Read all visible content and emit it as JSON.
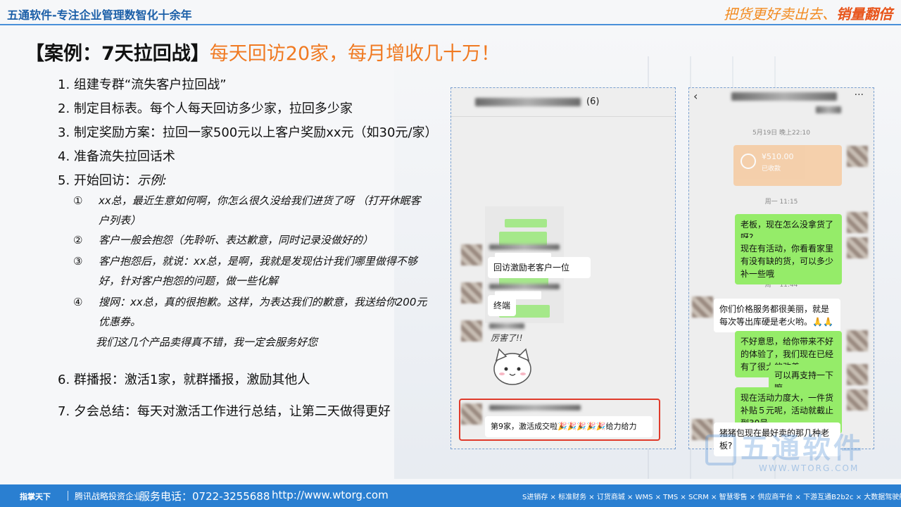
{
  "header": {
    "brand": "五通软件-专注企业管理数智化十余年",
    "slogan_part1": "把货更好卖出去、",
    "slogan_part2": "销量翻倍"
  },
  "heading": {
    "main": "【案例：7天拉回战】",
    "sub": "每天回访20家，每月增收几十万！"
  },
  "steps": [
    "1. 组建专群“流失客户拉回战”",
    "2. 制定目标表。每个人每天回访多少家，拉回多少家",
    "3.  制定奖励方案：拉回一家500元以上客户奖励xx元（如30元/家）",
    "4. 准备流失拉回话术",
    "5. 开始回访：",
    "6. 群播报：激活1家，就群播报，激励其他人",
    "7. 夕会总结：每天对激活工作进行总结，让第二天做得更好"
  ],
  "step5_example": "示例:",
  "script_items": [
    {
      "num": "①",
      "line1": "xx总，最近生意如何啊，你怎么很久没给我们进货了呀 （打开休眠客",
      "line2": "户列表）"
    },
    {
      "num": "②",
      "line1": "客户一般会抱怨（先聆听、表达歉意，同时记录没做好的）",
      "line2": ""
    },
    {
      "num": "③",
      "line1": "客户抱怨后，就说：xx总，是啊，我就是发现估计我们哪里做得不够",
      "line2": "好，针对客户抱怨的问题，做一些化解"
    },
    {
      "num": "④",
      "line1": "搜网：xx总，真的很抱歉。这样，为表达我们的歉意，我送给你200元",
      "line2": "优惠券。"
    }
  ],
  "closing_line": "我们这几个产品卖得真不错，我一定会服务好您",
  "left_chat": {
    "group_count": "(6)",
    "msg1": "回访激励老客户一位",
    "msg2": "终端",
    "sticker_text": "厉害了!!",
    "msg3": "第9家，激活成交啦🎉🎉🎉🎉🎉给力给力"
  },
  "right_chat": {
    "time1": "5月19日 晚上22:10",
    "transfer_amount": "¥510.00",
    "transfer_status": "已收款",
    "time2": "周一 11:15",
    "msg1": "老板，现在怎么没拿货了呀?",
    "msg2": "现在有活动，你看看家里有没有缺的货，可以多少补一些哦",
    "time3": "周一 11:44",
    "msg3": "你们价格服务都很美丽，就是每次等出库硬是老火哟。🙏🙏",
    "msg4": "不好意思，给你带来不好的体验了，我们现在已经有了很大的改善",
    "msg5": "可以再支持一下嘛",
    "msg6": "现在活动力度大，一件货补贴５元呢，活动就截止到30号",
    "msg7": "猪猪包现在最好卖的那几种老板?"
  },
  "watermark": {
    "text": "五通软件",
    "url": "WWW.WTORG.COM"
  },
  "footer": {
    "logo": "指掌天下",
    "investor": "腾讯战略投资企业",
    "phone": "服务电话：0722-3255688",
    "url": "http://www.wtorg.com",
    "products": "S进销存 × 标准财务 × 订货商城 × WMS × TMS × SCRM × 智慧零售 × 供应商平台 × 下游互通B2b2c × 大数据驾驶舱  一体化"
  },
  "colors": {
    "brand_blue": "#1b5fa8",
    "accent_orange": "#f07a22",
    "footer_blue": "#2a7fd1",
    "wechat_green": "#95ec69",
    "highlight_red": "#e03a2a"
  }
}
